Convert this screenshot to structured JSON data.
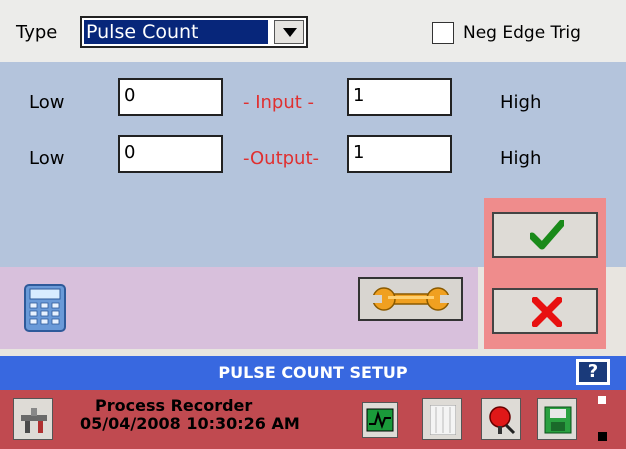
{
  "type_row": {
    "label": "Type",
    "selected_value": "Pulse Count",
    "neg_edge_label": "Neg Edge Trig",
    "neg_edge_checked": false
  },
  "input_row": {
    "low_label": "Low",
    "low_value": "0",
    "middle_label": "- Input -",
    "high_value": "1",
    "high_label": "High"
  },
  "output_row": {
    "low_label": "Low",
    "low_value": "0",
    "middle_label": "-Output-",
    "high_value": "1",
    "high_label": "High"
  },
  "title_bar": {
    "title": "PULSE COUNT SETUP",
    "help_label": "?"
  },
  "status_bar": {
    "app_name": "Process Recorder",
    "datetime": "05/04/2008 10:30:26 AM"
  },
  "colors": {
    "check_green": "#1a8a1a",
    "cancel_red": "#e81010",
    "title_blue": "#3868e0",
    "status_red": "#c04a50"
  },
  "icons": [
    "chevron-down-icon",
    "calculator-icon",
    "wrench-icon",
    "checkmark-icon",
    "cancel-x-icon",
    "tools-icon",
    "chart-icon",
    "grid-icon",
    "alarm-icon",
    "save-icon"
  ]
}
